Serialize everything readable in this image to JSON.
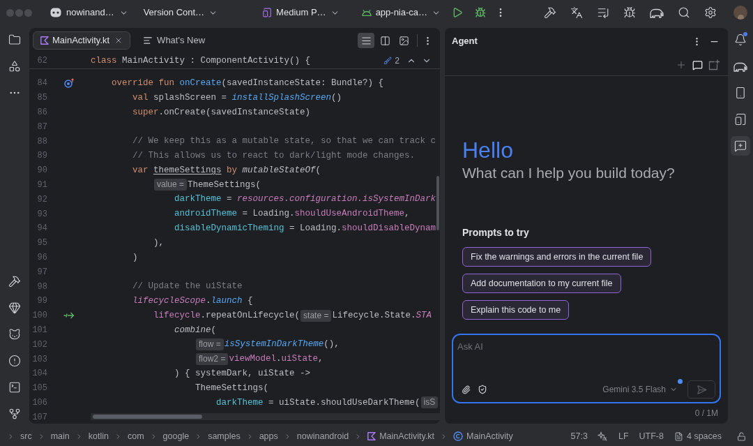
{
  "title_bar": {
    "project": "nowinand…",
    "vcs": "Version Cont…",
    "device": "Medium P…",
    "run_config": "app-nia-ca…"
  },
  "right_tools": [
    {
      "kind": "notifications",
      "selected": false,
      "badge": true
    },
    {
      "kind": "gradle",
      "selected": false,
      "badge": false
    },
    {
      "kind": "device_manager",
      "selected": false,
      "badge": false
    },
    {
      "kind": "running_devices",
      "selected": false,
      "badge": false
    },
    {
      "kind": "agent",
      "selected": true,
      "badge": false
    }
  ],
  "editor": {
    "tabs": [
      {
        "label": "MainActivity.kt",
        "kind": "kotlin",
        "selected": true
      },
      {
        "label": "What's New",
        "kind": "document",
        "selected": false
      }
    ],
    "view_modes": [
      {
        "kind": "code",
        "selected": true
      },
      {
        "kind": "split",
        "selected": false
      },
      {
        "kind": "design",
        "selected": false
      }
    ],
    "sticky_line": {
      "number": "62",
      "tokens": [
        {
          "kind": "keyword",
          "text": "class"
        },
        {
          "kind": "plain",
          "text": " MainActivity : ComponentActivity() {"
        }
      ]
    },
    "problem_count": "2",
    "lines": [
      {
        "number": "84",
        "marker": {
          "kind": "override"
        },
        "tokens": [
          {
            "kind": "keyword",
            "text": "    override fun "
          },
          {
            "kind": "function",
            "text": "onCreate"
          },
          {
            "kind": "plain",
            "text": "(savedInstanceState: Bundle?) {"
          }
        ]
      },
      {
        "number": "85",
        "tokens": [
          {
            "kind": "keyword",
            "text": "        val"
          },
          {
            "kind": "plain",
            "text": " splashScreen = "
          },
          {
            "kind": "call",
            "text": "installSplashScreen"
          },
          {
            "kind": "plain",
            "text": "()"
          }
        ]
      },
      {
        "number": "86",
        "tokens": [
          {
            "kind": "keyword",
            "text": "        super"
          },
          {
            "kind": "plain",
            "text": ".onCreate(savedInstanceState)"
          }
        ]
      },
      {
        "number": "87"
      },
      {
        "number": "88",
        "tokens": [
          {
            "kind": "comment",
            "text": "        // We keep this as a mutable state, so that we can track c"
          }
        ]
      },
      {
        "number": "89",
        "tokens": [
          {
            "kind": "comment",
            "text": "        // This allows us to react to dark/light mode changes."
          }
        ]
      },
      {
        "number": "90",
        "tokens": [
          {
            "kind": "keyword",
            "text": "        var "
          },
          {
            "kind": "underline",
            "text": "themeSettings"
          },
          {
            "kind": "keyword",
            "text": " by "
          },
          {
            "kind": "italic",
            "text": "mutableStateOf"
          },
          {
            "kind": "plain",
            "text": "("
          }
        ]
      },
      {
        "number": "91",
        "tokens": [
          {
            "kind": "hint",
            "text": "            value ="
          },
          {
            "kind": "plain",
            "text": "ThemeSettings("
          }
        ]
      },
      {
        "number": "92",
        "tokens": [
          {
            "kind": "named_arg",
            "text": "                darkTheme"
          },
          {
            "kind": "plain",
            "text": " = "
          },
          {
            "kind": "member_italic",
            "text": "resources.configuration.isSystemInDark"
          }
        ]
      },
      {
        "number": "93",
        "tokens": [
          {
            "kind": "named_arg",
            "text": "                androidTheme"
          },
          {
            "kind": "plain",
            "text": " = Loading."
          },
          {
            "kind": "member",
            "text": "shouldUseAndroidTheme"
          },
          {
            "kind": "plain",
            "text": ","
          }
        ]
      },
      {
        "number": "94",
        "tokens": [
          {
            "kind": "named_arg",
            "text": "                disableDynamicTheming"
          },
          {
            "kind": "plain",
            "text": " = Loading."
          },
          {
            "kind": "member",
            "text": "shouldDisableDynam"
          }
        ]
      },
      {
        "number": "95",
        "tokens": [
          {
            "kind": "plain",
            "text": "            ),"
          }
        ]
      },
      {
        "number": "96",
        "tokens": [
          {
            "kind": "plain",
            "text": "        )"
          }
        ]
      },
      {
        "number": "97"
      },
      {
        "number": "98",
        "tokens": [
          {
            "kind": "comment",
            "text": "        // Update the uiState"
          }
        ]
      },
      {
        "number": "99",
        "tokens": [
          {
            "kind": "member_italic",
            "text": "        lifecycleScope"
          },
          {
            "kind": "plain",
            "text": "."
          },
          {
            "kind": "call",
            "text": "launch"
          },
          {
            "kind": "plain",
            "text": " {"
          }
        ]
      },
      {
        "number": "100",
        "marker": {
          "kind": "suspend"
        },
        "tokens": [
          {
            "kind": "member",
            "text": "            lifecycle"
          },
          {
            "kind": "plain",
            "text": ".repeatOnLifecycle("
          },
          {
            "kind": "hint",
            "text": "state ="
          },
          {
            "kind": "plain",
            "text": "Lifecycle.State."
          },
          {
            "kind": "member_italic",
            "text": "STA"
          }
        ]
      },
      {
        "number": "101",
        "tokens": [
          {
            "kind": "italic",
            "text": "                combine"
          },
          {
            "kind": "plain",
            "text": "("
          }
        ]
      },
      {
        "number": "102",
        "tokens": [
          {
            "kind": "hint",
            "text": "                    flow ="
          },
          {
            "kind": "call",
            "text": "isSystemInDarkTheme"
          },
          {
            "kind": "plain",
            "text": "(),"
          }
        ]
      },
      {
        "number": "103",
        "tokens": [
          {
            "kind": "hint",
            "text": "                    flow2 ="
          },
          {
            "kind": "member",
            "text": "viewModel"
          },
          {
            "kind": "plain",
            "text": "."
          },
          {
            "kind": "member",
            "text": "uiState"
          },
          {
            "kind": "plain",
            "text": ","
          }
        ]
      },
      {
        "number": "104",
        "tokens": [
          {
            "kind": "plain",
            "text": "                ) { systemDark, uiState ->"
          }
        ]
      },
      {
        "number": "105",
        "tokens": [
          {
            "kind": "plain",
            "text": "                    ThemeSettings("
          }
        ]
      },
      {
        "number": "106",
        "tokens": [
          {
            "kind": "named_arg",
            "text": "                        darkTheme"
          },
          {
            "kind": "plain",
            "text": " = uiState.shouldUseDarkTheme("
          },
          {
            "kind": "hint",
            "text": "isS"
          }
        ]
      },
      {
        "number": "107"
      }
    ]
  },
  "agent": {
    "title": "Agent",
    "greeting": "Hello",
    "subtitle": "What can I help you build today?",
    "prompts_heading": "Prompts to try",
    "prompts": [
      "Fix the warnings and errors in the current file",
      "Add documentation to my current file",
      "Explain this code to me"
    ],
    "input": {
      "placeholder": "Ask AI"
    },
    "model": {
      "label": "Gemini 3.5 Flash",
      "badge": true
    },
    "send": {
      "disabled": true
    },
    "token_count": "0 / 1M"
  },
  "status_bar": {
    "breadcrumbs": [
      {
        "label": "src",
        "kind": "folder"
      },
      {
        "label": "main",
        "kind": "folder"
      },
      {
        "label": "kotlin",
        "kind": "folder"
      },
      {
        "label": "com",
        "kind": "folder"
      },
      {
        "label": "google",
        "kind": "folder"
      },
      {
        "label": "samples",
        "kind": "folder"
      },
      {
        "label": "apps",
        "kind": "folder"
      },
      {
        "label": "nowinandroid",
        "kind": "folder"
      },
      {
        "label": "MainActivity.kt",
        "kind": "file"
      },
      {
        "label": "MainActivity",
        "kind": "class"
      }
    ],
    "position": "57:3",
    "line_separator": "LF",
    "encoding": "UTF-8",
    "indent": "4 spaces"
  }
}
